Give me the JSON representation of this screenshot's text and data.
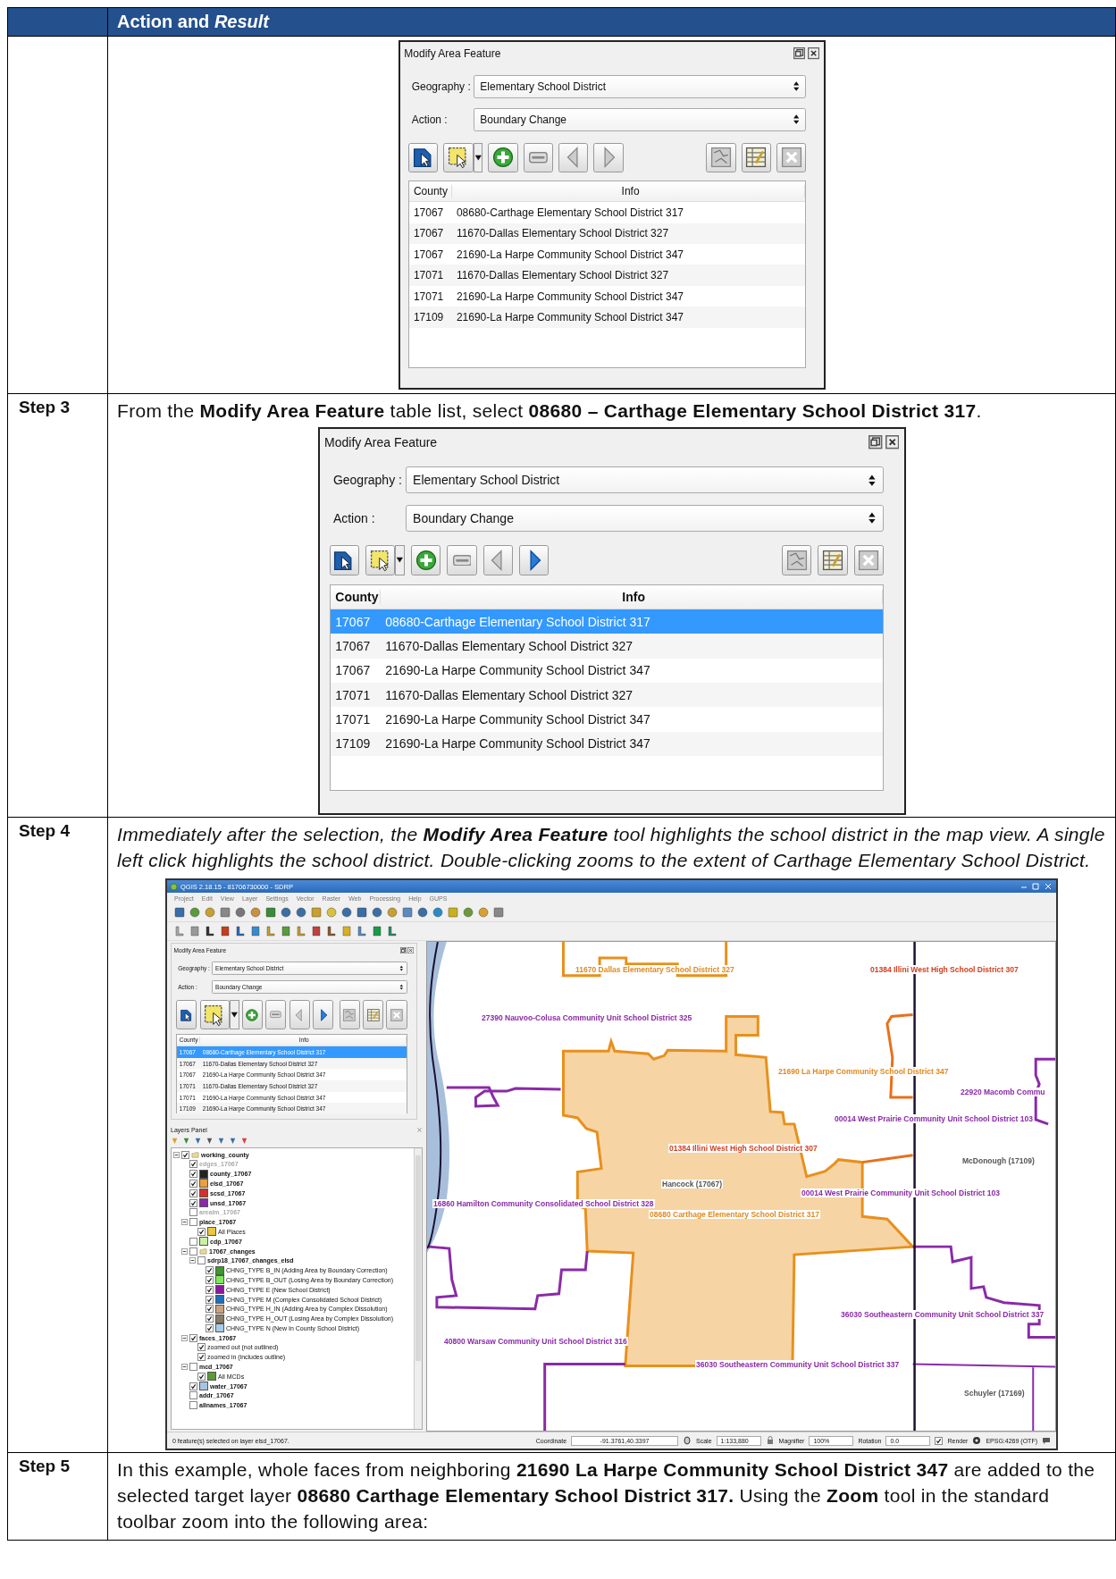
{
  "header": {
    "title": "Action and *Result*"
  },
  "rows": [
    {
      "figure": {
        "kind": "dialog",
        "title": "Modify Area Feature",
        "geography": {
          "label": "Geography :",
          "value": "Elementary School District"
        },
        "action": {
          "label": "Action :",
          "value": "Boundary Change"
        },
        "next_enabled": false,
        "columns": [
          "County",
          "Info"
        ],
        "rows": [
          {
            "county": "17067",
            "info": "08680-Carthage Elementary School District 317",
            "selected": false
          },
          {
            "county": "17067",
            "info": "11670-Dallas Elementary School District 327",
            "selected": false
          },
          {
            "county": "17067",
            "info": "21690-La Harpe Community School District 347",
            "selected": false
          },
          {
            "county": "17071",
            "info": "11670-Dallas Elementary School District 327",
            "selected": false
          },
          {
            "county": "17071",
            "info": "21690-La Harpe Community School District 347",
            "selected": false
          },
          {
            "county": "17109",
            "info": "21690-La Harpe Community School District 347",
            "selected": false
          }
        ]
      }
    },
    {
      "step": "Step 3",
      "italic": false,
      "text": "From the **Modify Area Feature** table list, select **08680 – Carthage Elementary School District 317**.",
      "figure": {
        "kind": "dialog",
        "title": "Modify Area Feature",
        "geography": {
          "label": "Geography :",
          "value": "Elementary School District"
        },
        "action": {
          "label": "Action :",
          "value": "Boundary Change"
        },
        "next_enabled": true,
        "columns": [
          "County",
          "Info"
        ],
        "rows": [
          {
            "county": "17067",
            "info": "08680-Carthage Elementary School District 317",
            "selected": true
          },
          {
            "county": "17067",
            "info": "11670-Dallas Elementary School District 327",
            "selected": false
          },
          {
            "county": "17067",
            "info": "21690-La Harpe Community School District 347",
            "selected": false
          },
          {
            "county": "17071",
            "info": "11670-Dallas Elementary School District 327",
            "selected": false
          },
          {
            "county": "17071",
            "info": "21690-La Harpe Community School District 347",
            "selected": false
          },
          {
            "county": "17109",
            "info": "21690-La Harpe Community School District 347",
            "selected": false
          }
        ]
      }
    },
    {
      "step": "Step 4",
      "italic": true,
      "text": "Immediately after the selection, the **Modify Area Feature** tool highlights the school district in the map view. A single left click highlights the school district. Double-clicking zooms to the extent of Carthage Elementary School District.",
      "figure": {
        "kind": "qgis",
        "title": "QGIS 2.18.15 - 81706730000 - SDRP",
        "menu": [
          "Project",
          "Edit",
          "View",
          "Layer",
          "Settings",
          "Vector",
          "Raster",
          "Web",
          "Processing",
          "Help",
          "GUPS"
        ],
        "panel": {
          "title": "Modify Area Feature",
          "geography": {
            "label": "Geography :",
            "value": "Elementary School District"
          },
          "action": {
            "label": "Action :",
            "value": "Boundary Change"
          },
          "next_enabled": true,
          "columns": [
            "County",
            "Info"
          ],
          "rows": [
            {
              "county": "17067",
              "info": "08680-Carthage Elementary School District 317",
              "selected": true
            },
            {
              "county": "17067",
              "info": "11670-Dallas Elementary School District 327",
              "selected": false
            },
            {
              "county": "17067",
              "info": "21690-La Harpe Community School District 347",
              "selected": false
            },
            {
              "county": "17071",
              "info": "11670-Dallas Elementary School District 327",
              "selected": false
            },
            {
              "county": "17071",
              "info": "21690-La Harpe Community School District 347",
              "selected": false
            },
            {
              "county": "17109",
              "info": "21690-La Harpe Community School District 347",
              "selected": false
            }
          ]
        },
        "layers": {
          "title": "Layers Panel",
          "tree": [
            {
              "label": "working_county",
              "kind": "group",
              "checked": true,
              "disabled": false,
              "children": [
                {
                  "label": "edges_17067",
                  "kind": "layer",
                  "checked": true,
                  "disabled": true
                },
                {
                  "label": "county_17067",
                  "kind": "layer",
                  "checked": true,
                  "disabled": false,
                  "color": "#222222"
                },
                {
                  "label": "elsd_17067",
                  "kind": "layer",
                  "checked": true,
                  "disabled": false,
                  "color": "#e8a040"
                },
                {
                  "label": "scsd_17067",
                  "kind": "layer",
                  "checked": true,
                  "disabled": false,
                  "color": "#d03030"
                },
                {
                  "label": "unsd_17067",
                  "kind": "layer",
                  "checked": true,
                  "disabled": false,
                  "color": "#8a2aa8"
                },
                {
                  "label": "arealm_17067",
                  "kind": "layer",
                  "checked": false,
                  "disabled": true
                },
                {
                  "label": "place_17067",
                  "kind": "layer",
                  "checked": false,
                  "disabled": false,
                  "children": [
                    {
                      "label": "All Places",
                      "kind": "class",
                      "checked": true,
                      "disabled": false,
                      "color": "#e8c840"
                    }
                  ]
                },
                {
                  "label": "cdp_17067",
                  "kind": "layer",
                  "checked": false,
                  "disabled": false,
                  "color": "#c8f0a0"
                },
                {
                  "label": "17067_changes",
                  "kind": "group",
                  "checked": false,
                  "disabled": false,
                  "children": [
                    {
                      "label": "sdrp18_17067_changes_elsd",
                      "kind": "layer",
                      "checked": false,
                      "disabled": false,
                      "children": [
                        {
                          "label": "CHNG_TYPE B_IN (Adding Area by Boundary Correction)",
                          "kind": "class",
                          "checked": true,
                          "disabled": false,
                          "color": "#3a9a2a"
                        },
                        {
                          "label": "CHNG_TYPE B_OUT (Losing Area by Boundary Correction)",
                          "kind": "class",
                          "checked": true,
                          "disabled": false,
                          "color": "#7ee85a"
                        },
                        {
                          "label": "CHNG_TYPE E (New School District)",
                          "kind": "class",
                          "checked": true,
                          "disabled": false,
                          "color": "#8a1a9a"
                        },
                        {
                          "label": "CHNG_TYPE M (Complex Consolidated School District)",
                          "kind": "class",
                          "checked": true,
                          "disabled": false,
                          "color": "#1e6eb8"
                        },
                        {
                          "label": "CHNG_TYPE H_IN (Adding Area by Complex Dissolution)",
                          "kind": "class",
                          "checked": true,
                          "disabled": false,
                          "color": "#c9a27e"
                        },
                        {
                          "label": "CHNG_TYPE H_OUT (Losing Area by Complex Dissolution)",
                          "kind": "class",
                          "checked": true,
                          "disabled": false,
                          "color": "#8a7a66"
                        },
                        {
                          "label": "CHNG_TYPE N (New In County School District)",
                          "kind": "class",
                          "checked": true,
                          "disabled": false,
                          "color": "#a8cce8"
                        }
                      ]
                    }
                  ]
                },
                {
                  "label": "faces_17067",
                  "kind": "layer",
                  "checked": true,
                  "disabled": false,
                  "children": [
                    {
                      "label": "zoomed out (not outlined)",
                      "kind": "class",
                      "checked": true,
                      "disabled": false
                    },
                    {
                      "label": "zoomed in (includes outline)",
                      "kind": "class",
                      "checked": true,
                      "disabled": false
                    }
                  ]
                },
                {
                  "label": "mcd_17067",
                  "kind": "layer",
                  "checked": false,
                  "disabled": false,
                  "children": [
                    {
                      "label": "All MCDs",
                      "kind": "class",
                      "checked": true,
                      "disabled": false,
                      "color": "#5a9a3a"
                    }
                  ]
                },
                {
                  "label": "water_17067",
                  "kind": "layer",
                  "checked": true,
                  "disabled": false,
                  "color": "#a8c4e0"
                },
                {
                  "label": "addr_17067",
                  "kind": "layer",
                  "checked": false,
                  "disabled": false
                },
                {
                  "label": "allnames_17067",
                  "kind": "layer",
                  "checked": false,
                  "disabled": false
                }
              ]
            }
          ]
        },
        "map_labels": [
          {
            "text": "11670 Dallas Elementary School District 327",
            "color": "#e08a20"
          },
          {
            "text": "01384 Illini West High School District 307",
            "color": "#d04020"
          },
          {
            "text": "27390 Nauvoo-Colusa Community Unit School District 325",
            "color": "#8a2aa8"
          },
          {
            "text": "21690 La Harpe Community School District 347",
            "color": "#e08a20"
          },
          {
            "text": "22920 Macomb Commu",
            "color": "#8a2aa8"
          },
          {
            "text": "00014 West Prairie Community Unit School District 103",
            "color": "#8a2aa8"
          },
          {
            "text": "01384 Illini West High School District 307",
            "color": "#d04020"
          },
          {
            "text": "McDonough (17109)",
            "color": "#555555"
          },
          {
            "text": "Hancock (17067)",
            "color": "#555555"
          },
          {
            "text": "16860 Hamilton Community Consolidated School District 328",
            "color": "#8a2aa8"
          },
          {
            "text": "00014 West Prairie Community Unit School District 103",
            "color": "#8a2aa8"
          },
          {
            "text": "08680 Carthage Elementary School District 317",
            "color": "#e08a20"
          },
          {
            "text": "36030 Southeastern Community Unit School District 337",
            "color": "#8a2aa8"
          },
          {
            "text": "40800 Warsaw Community Unit School District 316",
            "color": "#8a2aa8"
          },
          {
            "text": "36030 Southeastern Community Unit School District 337",
            "color": "#8a2aa8"
          },
          {
            "text": "Schuyler (17169)",
            "color": "#555555"
          }
        ],
        "status": {
          "message": "0 feature(s) selected on layer elsd_17067.",
          "coordinate_label": "Coordinate",
          "coordinate": "-91.3761,40.3397",
          "scale_label": "Scale",
          "scale": "1:133,880",
          "magnifier_label": "Magnifier",
          "magnifier": "100%",
          "rotation_label": "Rotation",
          "rotation": "0.0",
          "render_label": "Render",
          "render_checked": true,
          "crs": "EPSG:4269 (OTF)"
        }
      }
    },
    {
      "step": "Step 5",
      "italic": false,
      "text": "In this example, whole faces from neighboring **21690 La Harpe Community School District 347** are added to the selected target layer **08680 Carthage Elementary School District 317.** Using the **Zoom** tool in the standard toolbar zoom into the following area:"
    }
  ]
}
